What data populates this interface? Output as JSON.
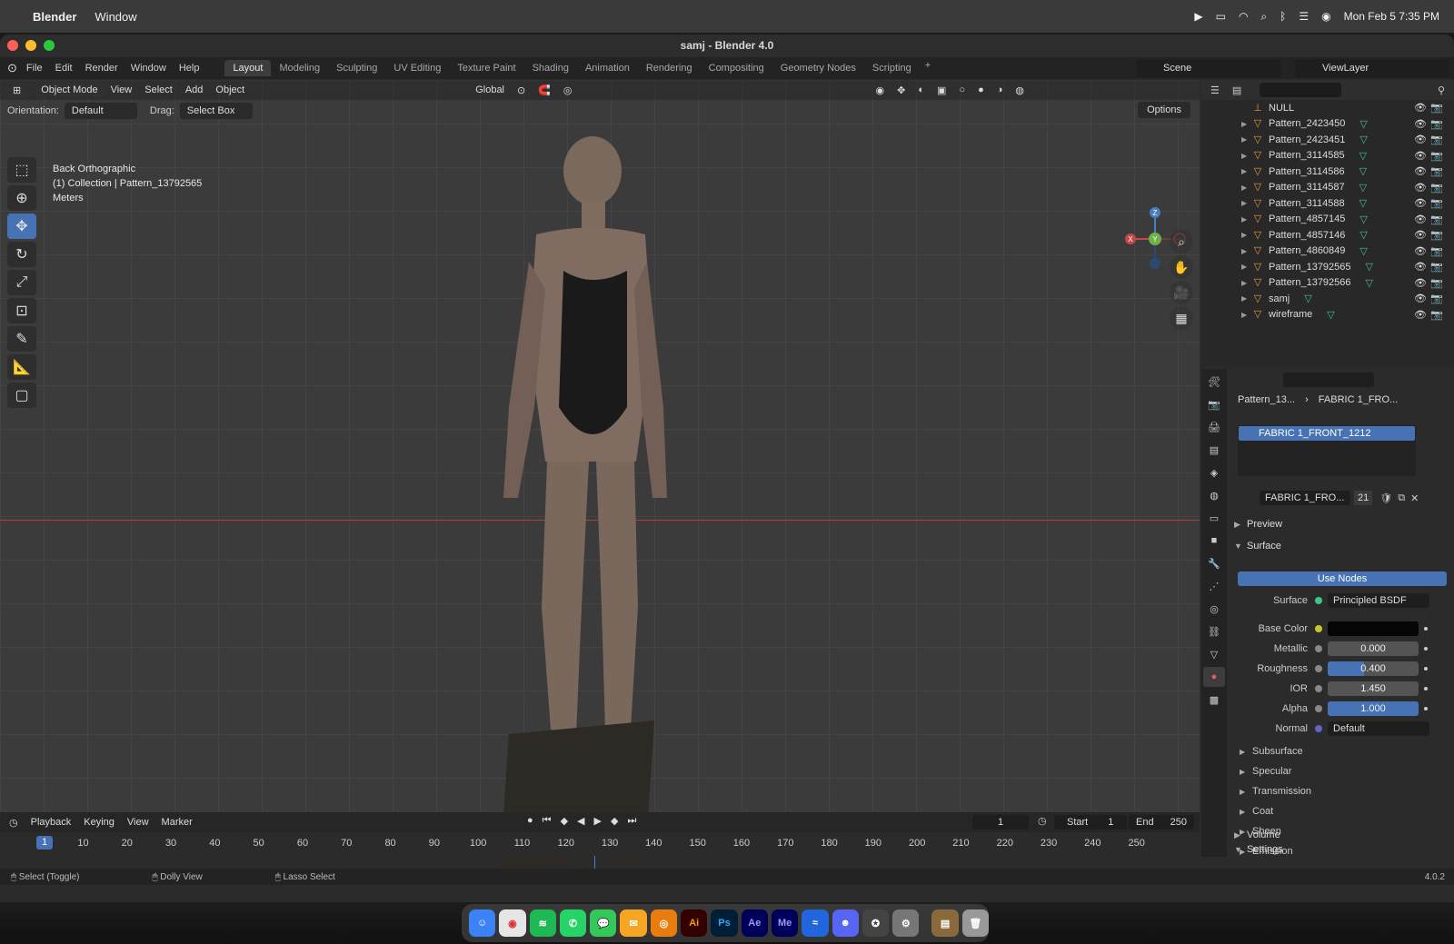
{
  "mac_menubar": {
    "app_name": "Blender",
    "menu_window": "Window",
    "datetime": "Mon Feb 5  7:35 PM"
  },
  "window": {
    "title": "samj - Blender 4.0"
  },
  "topbar": {
    "menus": [
      "File",
      "Edit",
      "Render",
      "Window",
      "Help"
    ],
    "workspaces": [
      "Layout",
      "Modeling",
      "Sculpting",
      "UV Editing",
      "Texture Paint",
      "Shading",
      "Animation",
      "Rendering",
      "Compositing",
      "Geometry Nodes",
      "Scripting"
    ],
    "active_workspace": "Layout",
    "scene": "Scene",
    "view_layer": "ViewLayer"
  },
  "viewport": {
    "mode": "Object Mode",
    "menus": [
      "View",
      "Select",
      "Add",
      "Object"
    ],
    "transform_orientation": "Global",
    "orientation_label": "Orientation:",
    "orientation_value": "Default",
    "drag_label": "Drag:",
    "drag_value": "Select Box",
    "options": "Options",
    "info_line1": "Back Orthographic",
    "info_line2": "(1) Collection | Pattern_13792565",
    "info_line3": "Meters",
    "gizmo_axes": {
      "z": "Z",
      "y": "Y",
      "x": "X"
    }
  },
  "outliner": {
    "rows": [
      {
        "name": "NULL",
        "icon": "empty-icon"
      },
      {
        "name": "Pattern_2423450",
        "icon": "mesh-icon"
      },
      {
        "name": "Pattern_2423451",
        "icon": "mesh-icon"
      },
      {
        "name": "Pattern_3114585",
        "icon": "mesh-icon"
      },
      {
        "name": "Pattern_3114586",
        "icon": "mesh-icon"
      },
      {
        "name": "Pattern_3114587",
        "icon": "mesh-icon"
      },
      {
        "name": "Pattern_3114588",
        "icon": "mesh-icon"
      },
      {
        "name": "Pattern_4857145",
        "icon": "mesh-icon"
      },
      {
        "name": "Pattern_4857146",
        "icon": "mesh-icon"
      },
      {
        "name": "Pattern_4860849",
        "icon": "mesh-icon"
      },
      {
        "name": "Pattern_13792565",
        "icon": "mesh-icon"
      },
      {
        "name": "Pattern_13792566",
        "icon": "mesh-icon"
      },
      {
        "name": "samj",
        "icon": "mesh-icon"
      },
      {
        "name": "wireframe",
        "icon": "mesh-icon"
      }
    ]
  },
  "properties": {
    "breadcrumb_object": "Pattern_13...",
    "breadcrumb_material": "FABRIC 1_FRO...",
    "slot_name": "FABRIC 1_FRONT_1212",
    "material_name": "FABRIC 1_FRO...",
    "material_users": "21",
    "panels": {
      "preview": "Preview",
      "surface": "Surface",
      "volume": "Volume",
      "settings": "Settings"
    },
    "use_nodes": "Use Nodes",
    "surface_label": "Surface",
    "surface_shader": "Principled BSDF",
    "base_color_label": "Base Color",
    "metallic_label": "Metallic",
    "metallic": "0.000",
    "roughness_label": "Roughness",
    "roughness": "0.400",
    "roughness_fraction": 0.4,
    "ior_label": "IOR",
    "ior": "1.450",
    "alpha_label": "Alpha",
    "alpha": "1.000",
    "alpha_fraction": 1.0,
    "normal_label": "Normal",
    "normal": "Default",
    "subpanels": [
      "Subsurface",
      "Specular",
      "Transmission",
      "Coat",
      "Sheen",
      "Emission"
    ]
  },
  "timeline": {
    "menus": [
      "Playback",
      "Keying",
      "View",
      "Marker"
    ],
    "current_frame": "1",
    "start_label": "Start",
    "start": "1",
    "end_label": "End",
    "end": "250",
    "ruler_frame": "1",
    "ticks": [
      "10",
      "20",
      "30",
      "40",
      "50",
      "60",
      "70",
      "80",
      "90",
      "100",
      "110",
      "120",
      "130",
      "140",
      "150",
      "160",
      "170",
      "180",
      "190",
      "200",
      "210",
      "220",
      "230",
      "240",
      "250"
    ]
  },
  "statusbar": {
    "select": "Select (Toggle)",
    "dolly": "Dolly View",
    "lasso": "Lasso Select",
    "version": "4.0.2"
  },
  "dock": {
    "labels": [
      "Ai",
      "Ps",
      "Ae",
      "Me"
    ]
  },
  "colors": {
    "accent": "#4772b3",
    "mesh_orange": "#e89a3c",
    "modifier_green": "#3ec48a"
  }
}
